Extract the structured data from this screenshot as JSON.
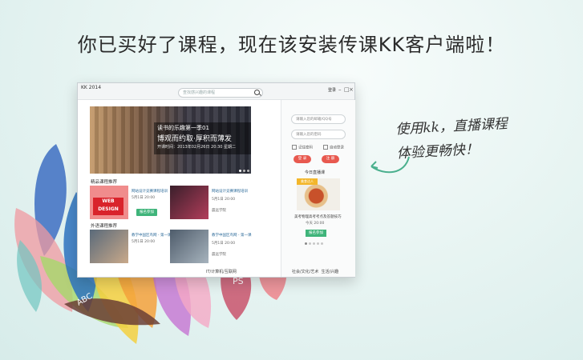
{
  "headline": "你已买好了课程，现在该安装传课KK客户端啦！",
  "note": {
    "line1": "使用kk，直播课程",
    "line2": "体验更畅快！"
  },
  "window": {
    "title": "KK 2014",
    "search_placeholder": "查找感兴趣的课程",
    "login_link": "登录",
    "controls": [
      "–",
      "□",
      "×"
    ]
  },
  "banner": {
    "line1": "读书的乐趣第一季01",
    "line2": "博观而约取·厚积而薄发",
    "line3": "开课时间：2013年02月26日 20:30 星期二"
  },
  "sections": {
    "recommended": "精品课程推荐",
    "external": "外语课程推荐"
  },
  "courses": [
    {
      "title": "网站设计竞赛课程培训",
      "lines": [
        "5月1日 20:00",
        "20:00"
      ],
      "button": "报名参加",
      "badge": "WEB DESIGN"
    },
    {
      "title": "网站设计竞赛课程培训",
      "lines": [
        "5月1日 20:00",
        "20:00",
        "晨远学院"
      ],
      "button": ""
    },
    {
      "title": "教学中国区鸟网 - 第一课",
      "lines": [
        "5月1日 20:00",
        "20:00"
      ],
      "button": ""
    },
    {
      "title": "教学中国区鸟网 - 第一课",
      "lines": [
        "5月1日 20:00",
        "20:00",
        "晨远学院"
      ],
      "button": ""
    }
  ],
  "bottom_categories": [
    "IT/计算机/互联网",
    "生活/兴趣",
    "社会/文化/艺术",
    "生活/兴趣"
  ],
  "login": {
    "account_placeholder": "请输入您的邮箱/QQ号",
    "password_placeholder": "请输入您的密码",
    "remember": "记住密码",
    "auto_login": "自动登录",
    "login_btn": "登 录",
    "register_btn": "注 册"
  },
  "live": {
    "title": "今日直播课",
    "tag": "美食达人",
    "desc": "美考物理高考考点及答题技巧",
    "time": "今天 20:00",
    "button": "报名参加"
  },
  "petal_labels": [
    "ABC",
    "PS"
  ],
  "colors": {
    "accent_green": "#3fb47a",
    "accent_red": "#e8594f",
    "link_blue": "#2d6b9a"
  }
}
